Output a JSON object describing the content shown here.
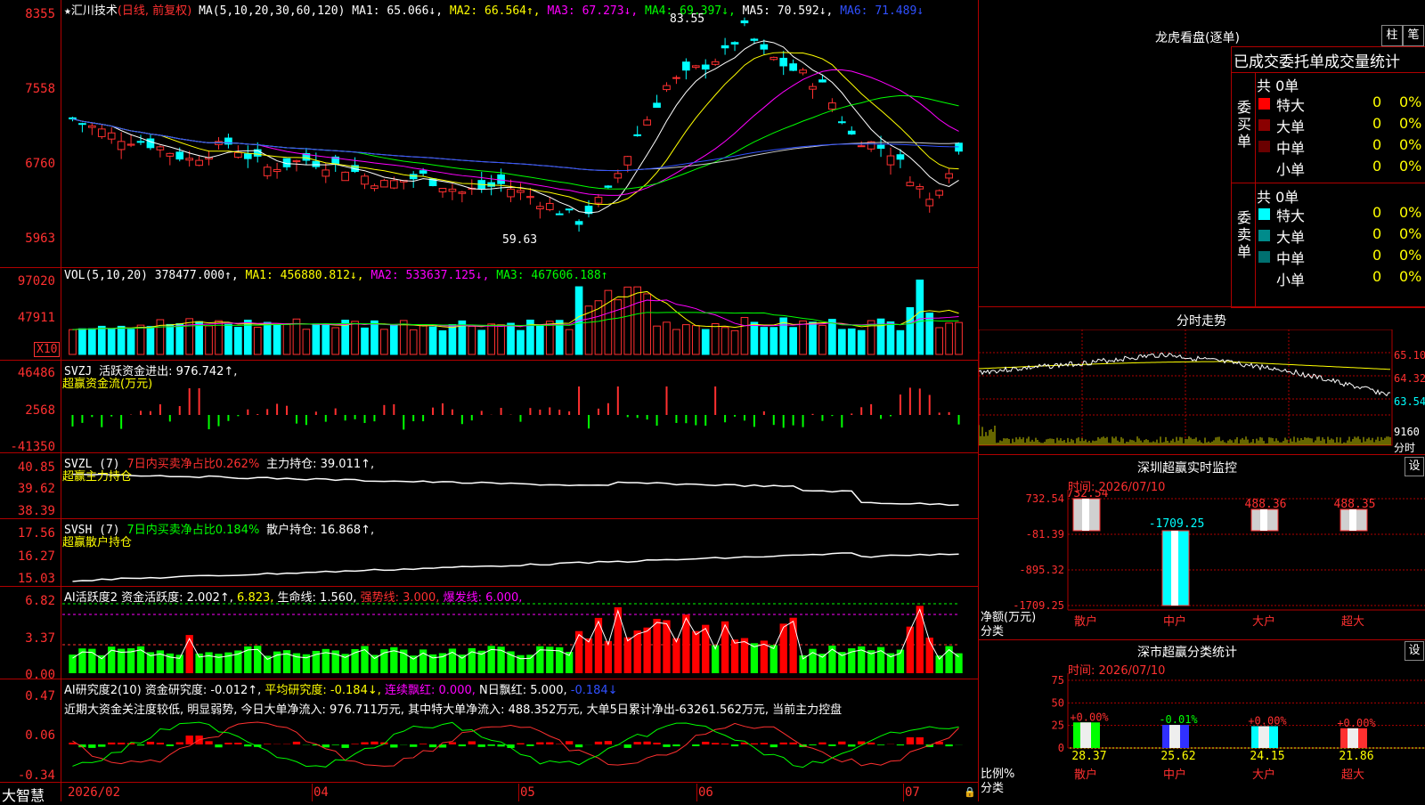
{
  "title_bar": {
    "stock_name": "汇川技术",
    "mode": "(日线, 前复权)",
    "ma_label": "MA(5,10,20,30,60,120)",
    "ma1": "MA1: 65.066↓,",
    "ma2": "MA2: 66.564↑,",
    "ma3": "MA3: 67.273↓,",
    "ma4": "MA4: 69.397↓,",
    "ma5": "MA5: 70.592↓,",
    "ma6": "MA6: 71.489↓",
    "high_mark": "83.55",
    "low_mark": "59.63"
  },
  "vol": {
    "title": "VOL(5,10,20)",
    "value": "378477.000↑,",
    "ma1": "MA1: 456880.812↓,",
    "ma2": "MA2: 533637.125↓,",
    "ma3": "MA3: 467606.188↑",
    "unit": "X10"
  },
  "svzj": {
    "title": "SVZJ",
    "text": "活跃资金进出: 976.742↑,",
    "sub": "超赢资金流(万元)"
  },
  "svzl": {
    "title": "SVZL (7)",
    "ratio": "7日内买卖净占比0.262%",
    "hold": "主力持仓: 39.011↑,",
    "sub": "超赢主力持仓"
  },
  "svsh": {
    "title": "SVSH (7)",
    "ratio": "7日内买卖净占比0.184%",
    "hold": "散户持仓: 16.868↑,",
    "sub": "超赢散户持仓"
  },
  "ai1": {
    "title": "AI活跃度2",
    "a": "资金活跃度: 2.002↑,",
    "b": "6.823,",
    "c": "生命线: 1.560,",
    "d": "强势线: 3.000,",
    "e": "爆发线: 6.000,"
  },
  "ai2": {
    "title": "AI研究度2(10)",
    "a": "资金研究度: -0.012↑,",
    "b": "平均研究度: -0.184↓,",
    "c": "连续飘红: 0.000,",
    "d": "N日飘红: 5.000,",
    "e": "-0.184↓",
    "comment": "近期大资金关注度较低, 明显弱势, 今日大单净流入: 976.711万元, 其中特大单净流入: 488.352万元, 大单5日累计净出-63261.562万元, 当前主力控盘"
  },
  "axes": {
    "main": [
      "8355",
      "7558",
      "6760",
      "5963"
    ],
    "vol": [
      "97020",
      "47911"
    ],
    "svzj": [
      "46486",
      "2568",
      "-41350"
    ],
    "svzl": [
      "40.85",
      "39.62",
      "38.39"
    ],
    "svsh": [
      "17.56",
      "16.27",
      "15.03"
    ],
    "ai1": [
      "6.82",
      "3.37",
      "0.00"
    ],
    "ai2": [
      "0.47",
      "0.06",
      "-0.34"
    ]
  },
  "date_axis": {
    "brand": "大智慧",
    "labels": [
      "2026/02",
      "04",
      "05",
      "06",
      "07"
    ]
  },
  "right": {
    "tab1": "柱",
    "tab2": "笔",
    "lhb_title": "龙虎看盘(逐单)",
    "stat_title": "已成交委托单成交量统计",
    "buy_label": "委买单",
    "sell_label": "委卖单",
    "buy_total": "共 0单",
    "sell_total": "共 0单",
    "rows": [
      {
        "name": "特大",
        "val": "0",
        "pct": "0%"
      },
      {
        "name": "大单",
        "val": "0",
        "pct": "0%"
      },
      {
        "name": "中单",
        "val": "0",
        "pct": "0%"
      },
      {
        "name": "小单",
        "val": "0",
        "pct": "0%"
      }
    ],
    "sell_rows": [
      {
        "name": "特大",
        "val": "0",
        "pct": "0%"
      },
      {
        "name": "大单",
        "val": "0",
        "pct": "0%"
      },
      {
        "name": "中单",
        "val": "0",
        "pct": "0%"
      },
      {
        "name": "小单",
        "val": "0",
        "pct": "0%"
      }
    ],
    "intraday_title": "分时走势",
    "intraday_axis": [
      "65.10",
      "64.32",
      "63.54"
    ],
    "intraday_vol": "9160",
    "intraday_tag": "分时",
    "monitor_title": "深圳超赢实时监控",
    "set": "设",
    "monitor_time": "时间: 2026/07/10",
    "monitor_axis": [
      "732.54",
      "-81.39",
      "-895.32",
      "-1709.25"
    ],
    "monitor_ylabel": "净额(万元)",
    "monitor_xlabel": "分类",
    "monitor_values": [
      "732.54",
      "-1709.25",
      "488.36",
      "488.35"
    ],
    "categories": [
      "散户",
      "中户",
      "大户",
      "超大"
    ],
    "class_title": "深市超赢分类统计",
    "class_time": "时间: 2026/07/10",
    "class_axis": [
      "75",
      "50",
      "25",
      "0"
    ],
    "class_ylabel": "比例%",
    "class_xlabel": "分类",
    "class_changes": [
      "+0.00%",
      "-0.01%",
      "+0.00%",
      "+0.00%"
    ],
    "class_values": [
      "28.37",
      "25.62",
      "24.15",
      "21.86"
    ]
  },
  "chart_data": [
    {
      "type": "bar",
      "title": "深圳超赢实时监控",
      "categories": [
        "散户",
        "中户",
        "大户",
        "超大"
      ],
      "values": [
        732.54,
        -1709.25,
        488.36,
        488.35
      ],
      "ylabel": "净额(万元)",
      "xlabel": "分类",
      "ylim": [
        -1709.25,
        732.54
      ]
    },
    {
      "type": "bar",
      "title": "深市超赢分类统计",
      "categories": [
        "散户",
        "中户",
        "大户",
        "超大"
      ],
      "values": [
        28.37,
        25.62,
        24.15,
        21.86
      ],
      "ylabel": "比例%",
      "xlabel": "分类",
      "ylim": [
        0,
        75
      ]
    },
    {
      "type": "line",
      "title": "汇川技术 (日线, 前复权)",
      "ylim": [
        59.63,
        83.55
      ],
      "annotations": [
        "83.55",
        "59.63"
      ]
    }
  ]
}
